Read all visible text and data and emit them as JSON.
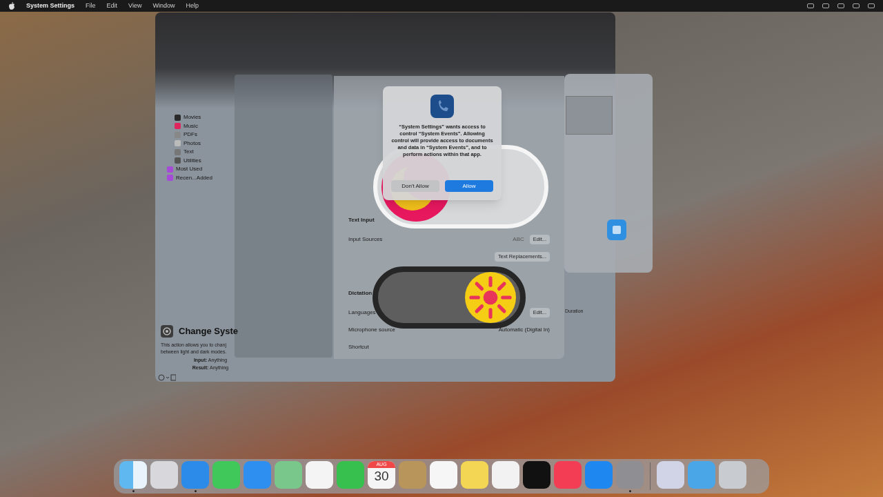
{
  "menu_bar": {
    "items": [
      {
        "label": "System Settings",
        "kind": "app"
      },
      {
        "label": "File",
        "kind": "menu"
      },
      {
        "label": "Edit",
        "kind": "menu"
      },
      {
        "label": "View",
        "kind": "menu"
      },
      {
        "label": "Window",
        "kind": "menu"
      },
      {
        "label": "Help",
        "kind": "menu"
      }
    ]
  },
  "shortcuts_window": {
    "sidebar": [
      {
        "label": "Movies",
        "kind": "movies"
      },
      {
        "label": "Music",
        "kind": "music"
      },
      {
        "label": "PDFs",
        "kind": "pdf"
      },
      {
        "label": "Photos",
        "kind": "photos"
      },
      {
        "label": "Text",
        "kind": "text"
      },
      {
        "label": "Utilities",
        "kind": "utilities"
      },
      {
        "label": "Most Used",
        "kind": "folder"
      },
      {
        "label": "Recen...Added",
        "kind": "folder"
      }
    ],
    "action": {
      "title": "Change Syste",
      "description": [
        "This action allows you to chanj",
        "between light and dark modes."
      ],
      "input": "**Input:** Anything",
      "result": "**Result:** Anything"
    },
    "duration_label": "Duration"
  },
  "keyboard_settings": {
    "rows": [
      {
        "kind": "heading",
        "label": "Text Input"
      },
      {
        "kind": "button_row",
        "label": "Input Sources",
        "value": "ABC",
        "button": "Edit..."
      },
      {
        "kind": "button_only",
        "button": "Text Replacements..."
      },
      {
        "kind": "heading",
        "label": "Dictation"
      },
      {
        "kind": "button_row",
        "label": "Languages",
        "button": "Edit..."
      },
      {
        "kind": "popup_row",
        "label": "Microphone source",
        "value": "Automatic (Digital In)"
      },
      {
        "kind": "label_only",
        "label": "Shortcut"
      }
    ]
  },
  "dialog": {
    "message": "“System Settings” wants access to control “System Events”. Allowing control will provide access to documents and data in “System Events”, and to perform actions within that app.",
    "buttons": [
      {
        "label": "Don't Allow",
        "default": false
      },
      {
        "label": "Allow",
        "default": true
      }
    ]
  },
  "toggles": [
    {
      "kind": "light",
      "on": false
    },
    {
      "kind": "dark",
      "on": true
    }
  ],
  "dock": {
    "items": [
      {
        "kind": "finder",
        "running": true
      },
      {
        "kind": "launchpad",
        "running": false
      },
      {
        "kind": "safari",
        "running": true
      },
      {
        "kind": "messages",
        "running": false
      },
      {
        "kind": "mail",
        "running": false
      },
      {
        "kind": "maps",
        "running": false
      },
      {
        "kind": "photos",
        "running": false
      },
      {
        "kind": "facetime",
        "running": false
      },
      {
        "kind": "calendar",
        "running": false,
        "month": "AUG",
        "day": "30"
      },
      {
        "kind": "contacts",
        "running": false
      },
      {
        "kind": "reminders",
        "running": false
      },
      {
        "kind": "notes",
        "running": false
      },
      {
        "kind": "freeform",
        "running": false
      },
      {
        "kind": "tv",
        "running": false
      },
      {
        "kind": "music",
        "running": false
      },
      {
        "kind": "appstore",
        "running": false
      },
      {
        "kind": "settings",
        "running": true
      },
      {
        "kind": "separator"
      },
      {
        "kind": "shortcuts-doc",
        "running": false
      },
      {
        "kind": "folder",
        "running": false
      },
      {
        "kind": "trash",
        "running": false
      }
    ]
  }
}
